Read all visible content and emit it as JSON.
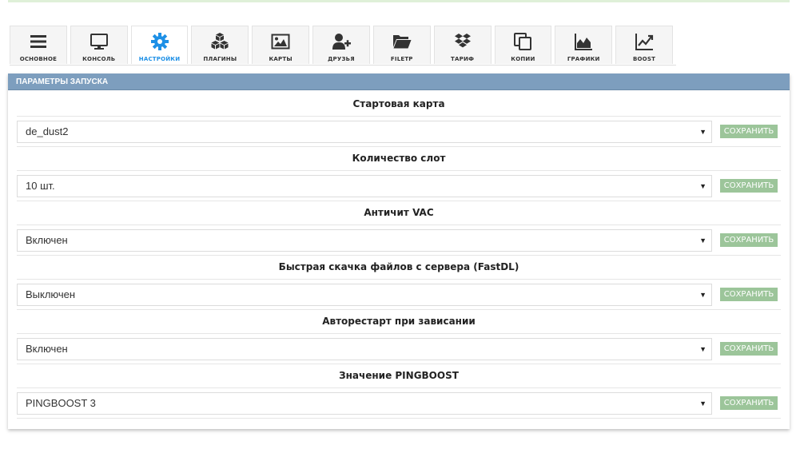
{
  "tabs": [
    {
      "label": "ОСНОВНОЕ",
      "icon": "menu-icon"
    },
    {
      "label": "КОНСОЛЬ",
      "icon": "monitor-icon"
    },
    {
      "label": "НАСТРОЙКИ",
      "icon": "gear-icon"
    },
    {
      "label": "ПЛАГИНЫ",
      "icon": "cubes-icon"
    },
    {
      "label": "КАРТЫ",
      "icon": "image-icon"
    },
    {
      "label": "ДРУЗЬЯ",
      "icon": "add-user-icon"
    },
    {
      "label": "FILETP",
      "icon": "folder-open-icon"
    },
    {
      "label": "ТАРИФ",
      "icon": "dropbox-icon"
    },
    {
      "label": "КОПИИ",
      "icon": "copy-icon"
    },
    {
      "label": "ГРАФИКИ",
      "icon": "area-chart-icon"
    },
    {
      "label": "BOOST",
      "icon": "line-chart-icon"
    }
  ],
  "active_tab": "НАСТРОЙКИ",
  "colors": {
    "active_tab": "#1e90e6",
    "panel_header": "#7d9ebe",
    "save_button": "#9cc59a"
  },
  "panel": {
    "title": "ПАРАМЕТРЫ ЗАПУСКА"
  },
  "settings": [
    {
      "title": "Стартовая карта",
      "value": "de_dust2",
      "save_label": "СОХРАНИТЬ"
    },
    {
      "title": "Количество слот",
      "value": "10 шт.",
      "save_label": "СОХРАНИТЬ"
    },
    {
      "title": "Античит VAC",
      "value": "Включен",
      "save_label": "СОХРАНИТЬ"
    },
    {
      "title": "Быстрая скачка файлов с сервера (FastDL)",
      "value": "Выключен",
      "save_label": "СОХРАНИТЬ"
    },
    {
      "title": "Авторестарт при зависании",
      "value": "Включен",
      "save_label": "СОХРАНИТЬ"
    },
    {
      "title": "Значение PINGBOOST",
      "value": "PINGBOOST 3",
      "save_label": "СОХРАНИТЬ"
    }
  ]
}
